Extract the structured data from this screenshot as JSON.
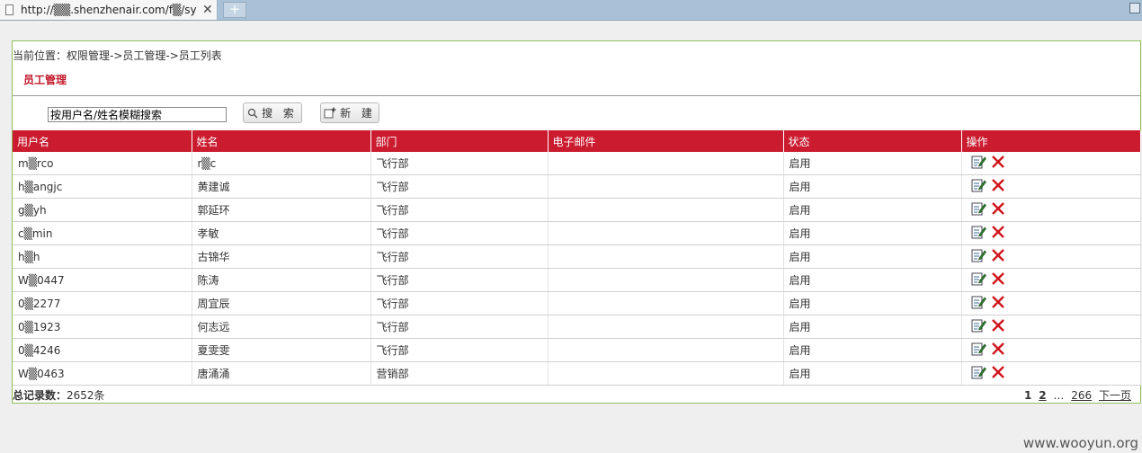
{
  "browser": {
    "tab_url": "http://▒▒.shenzhenair.com/f▒/sys",
    "close_glyph": "✕",
    "new_tab_glyph": "+"
  },
  "page": {
    "breadcrumb": "当前位置：权限管理->员工管理->员工列表",
    "title": "员工管理"
  },
  "toolbar": {
    "search_value": "按用户名/姓名模糊搜索",
    "search_label": "搜 索",
    "new_label": "新 建"
  },
  "table": {
    "headers": [
      "用户名",
      "姓名",
      "部门",
      "电子邮件",
      "状态",
      "操作"
    ],
    "rows": [
      {
        "username": "m▒rco",
        "name": "r▒c",
        "dept": "飞行部",
        "email": "",
        "status": "启用"
      },
      {
        "username": "h▒angjc",
        "name": "黄建诚",
        "dept": "飞行部",
        "email": "",
        "status": "启用"
      },
      {
        "username": "g▒yh",
        "name": "郭延环",
        "dept": "飞行部",
        "email": "",
        "status": "启用"
      },
      {
        "username": "c▒min",
        "name": "孝敏",
        "dept": "飞行部",
        "email": "",
        "status": "启用"
      },
      {
        "username": "h▒h",
        "name": "古锦华",
        "dept": "飞行部",
        "email": "",
        "status": "启用"
      },
      {
        "username": "W▒0447",
        "name": "陈涛",
        "dept": "飞行部",
        "email": "",
        "status": "启用"
      },
      {
        "username": "0▒2277",
        "name": "周宜辰",
        "dept": "飞行部",
        "email": "",
        "status": "启用"
      },
      {
        "username": "0▒1923",
        "name": "何志远",
        "dept": "飞行部",
        "email": "",
        "status": "启用"
      },
      {
        "username": "0▒4246",
        "name": "夏雯雯",
        "dept": "飞行部",
        "email": "",
        "status": "启用"
      },
      {
        "username": "W▒0463",
        "name": "唐涌涌",
        "dept": "营销部",
        "email": "",
        "status": "启用"
      }
    ]
  },
  "footer": {
    "total_label": "总记录数：",
    "total_value": "2652条",
    "pages": [
      "1",
      "2",
      "…",
      "266",
      "下一页"
    ]
  },
  "colors": {
    "accent_red": "#cb1b2f",
    "panel_border": "#8fc05a"
  },
  "watermark": "www.wooyun.org"
}
